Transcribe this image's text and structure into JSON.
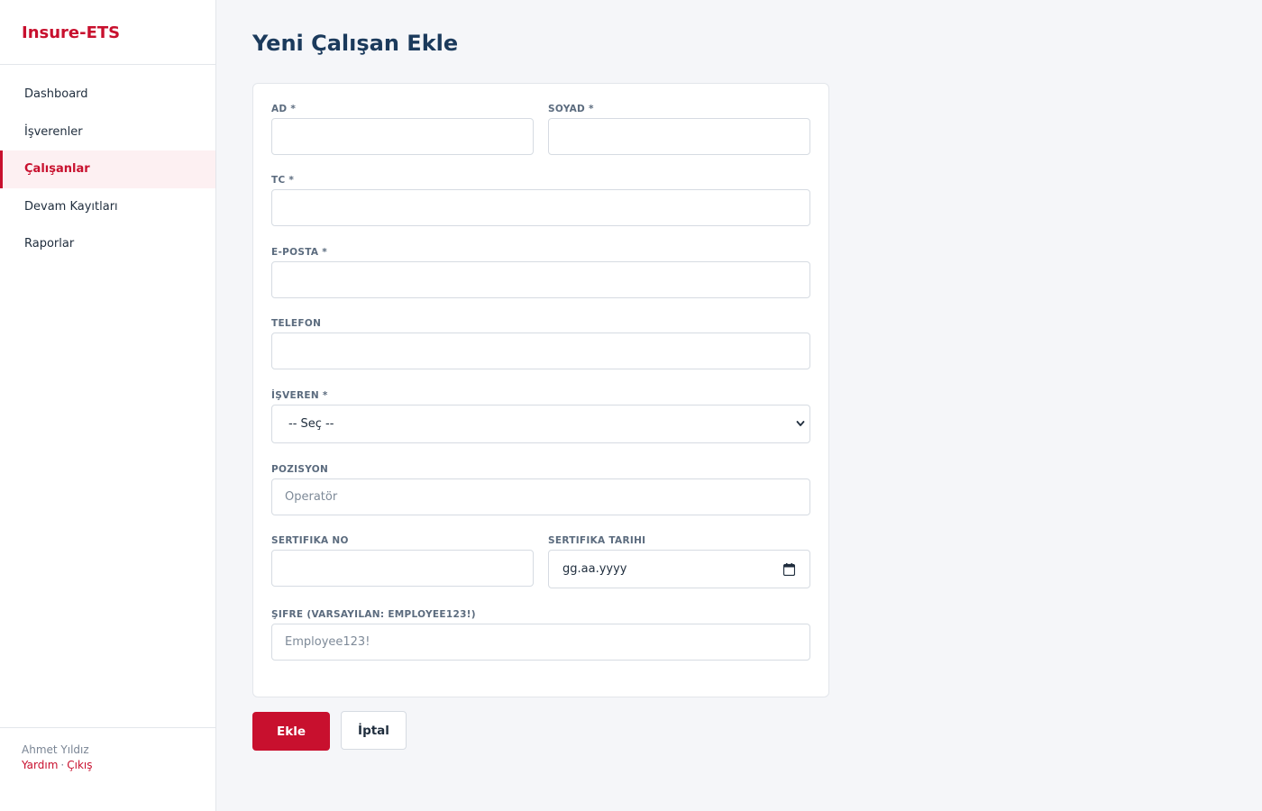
{
  "app": {
    "brand": "Insure-ETS"
  },
  "sidebar": {
    "items": [
      {
        "label": "Dashboard"
      },
      {
        "label": "İşverenler"
      },
      {
        "label": "Çalışanlar",
        "active": true
      },
      {
        "label": "Devam Kayıtları"
      },
      {
        "label": "Raporlar"
      }
    ],
    "footer": {
      "user_name": "Ahmet Yıldız",
      "help_link": "Yardım",
      "separator": "·",
      "logout_link": "Çıkış"
    }
  },
  "page": {
    "title": "Yeni Çalışan Ekle"
  },
  "form": {
    "first_name": {
      "label": "Ad *",
      "value": "",
      "placeholder": ""
    },
    "last_name": {
      "label": "Soyad *",
      "value": "",
      "placeholder": ""
    },
    "tc": {
      "label": "TC *",
      "value": "",
      "placeholder": ""
    },
    "email": {
      "label": "E-posta *",
      "value": "",
      "placeholder": ""
    },
    "phone": {
      "label": "Telefon",
      "value": "",
      "placeholder": ""
    },
    "employer": {
      "label": "İşveren *",
      "selected": "-- Seç --"
    },
    "position": {
      "label": "Pozisyon",
      "value": "",
      "placeholder": "Operatör"
    },
    "certificate_no": {
      "label": "Sertifika No",
      "value": "",
      "placeholder": ""
    },
    "certificate_date": {
      "label": "Sertifika Tarihi",
      "display": "gg.aa.yyyy"
    },
    "password": {
      "label": "Şifre (Varsayılan: Employee123!)",
      "value": "",
      "placeholder": "Employee123!"
    }
  },
  "actions": {
    "submit_label": "Ekle",
    "cancel_label": "İptal"
  },
  "colors": {
    "accent": "#c8102e",
    "title": "#1b3a5c",
    "background": "#f5f6f9"
  },
  "icons": {
    "employer_select": "chevron-down-icon",
    "certificate_date": "calendar-icon"
  }
}
